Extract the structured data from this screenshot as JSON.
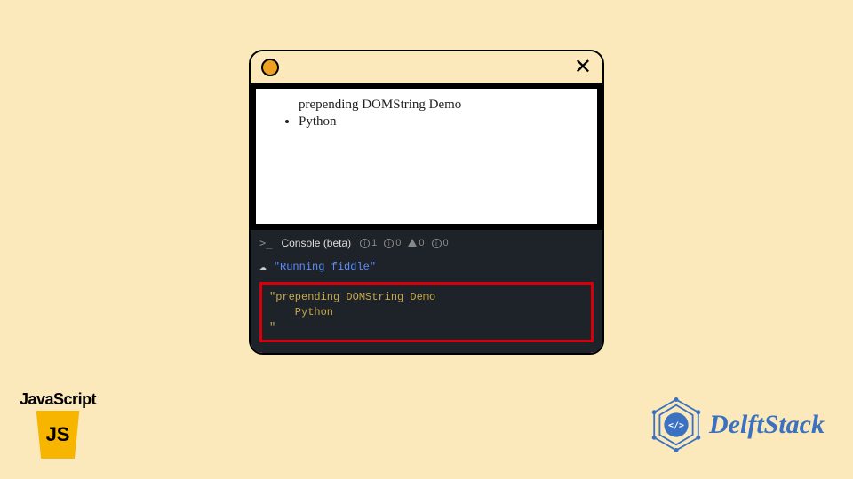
{
  "window": {
    "content": {
      "heading": "prepending DOMString Demo",
      "bullet": "Python"
    },
    "console": {
      "title": "Console (beta)",
      "badges": {
        "info_count": "1",
        "circle_count": "0",
        "warn_count": "0",
        "other_count": "0"
      },
      "running_msg": "\"Running fiddle\"",
      "output_line1": "\"prepending DOMString Demo",
      "output_line2": "    Python",
      "output_line3": "\""
    }
  },
  "logos": {
    "js_label": "JavaScript",
    "js_badge": "JS",
    "delft": "DelftStack"
  }
}
